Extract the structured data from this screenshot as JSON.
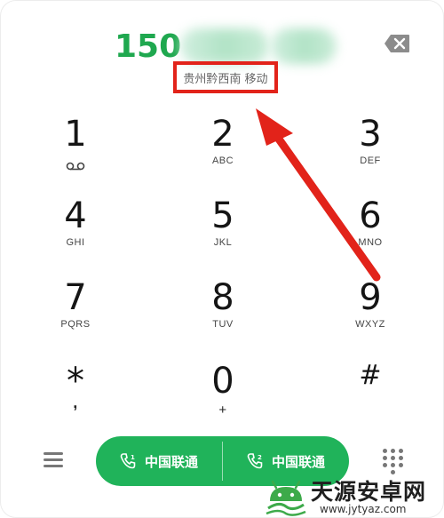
{
  "display": {
    "number_prefix": "150",
    "location": "贵州黔西南 移动"
  },
  "keypad": [
    {
      "digit": "1",
      "letters": ""
    },
    {
      "digit": "2",
      "letters": "ABC"
    },
    {
      "digit": "3",
      "letters": "DEF"
    },
    {
      "digit": "4",
      "letters": "GHI"
    },
    {
      "digit": "5",
      "letters": "JKL"
    },
    {
      "digit": "6",
      "letters": "MNO"
    },
    {
      "digit": "7",
      "letters": "PQRS"
    },
    {
      "digit": "8",
      "letters": "TUV"
    },
    {
      "digit": "9",
      "letters": "WXYZ"
    },
    {
      "digit": "*",
      "letters": ","
    },
    {
      "digit": "0",
      "letters": "+"
    },
    {
      "digit": "#",
      "letters": ""
    }
  ],
  "call_buttons": [
    {
      "label": "中国联通",
      "sim": "1"
    },
    {
      "label": "中国联通",
      "sim": "2"
    }
  ],
  "watermark": {
    "title": "天源安卓网",
    "url": "www.jytyaz.com"
  },
  "colors": {
    "accent_green": "#20b35a",
    "highlight_red": "#e2231a"
  },
  "icons": {
    "delete": "backspace-icon",
    "menu": "menu-icon",
    "dialpad": "dialpad-icon",
    "voicemail": "voicemail-icon",
    "call": "phone-icon"
  }
}
